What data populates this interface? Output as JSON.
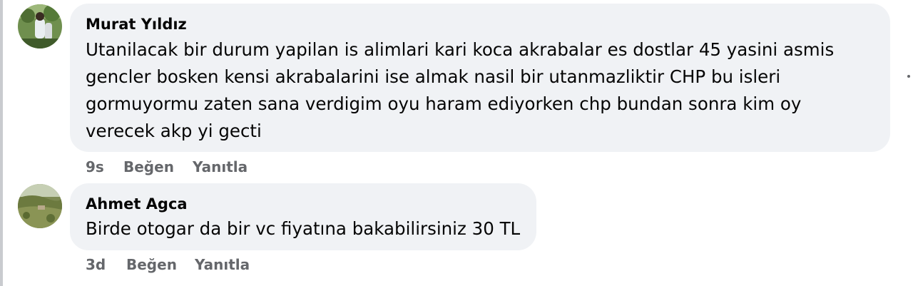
{
  "comments": [
    {
      "author": "Murat Yıldız",
      "lines": [
        "Utanilacak bir durum yapilan is alimlari kari koca akrabalar es dostlar 45 yasini asmis",
        "gencler bosken kensi akrabalarini ise almak nasil bir utanmazliktir CHP bu isleri",
        "gormuyormu zaten sana verdigim oyu haram ediyorken chp bundan sonra kim oy",
        "verecek akp yi gecti"
      ],
      "time": "9s",
      "like_label": "Beğen",
      "reply_label": "Yanıtla"
    },
    {
      "author": "Ahmet Agca",
      "lines": [
        "Birde otogar da bir vc fiyatına bakabilirsiniz 30 TL"
      ],
      "time": "3d",
      "like_label": "Beğen",
      "reply_label": "Yanıtla"
    }
  ],
  "icons": {
    "more_options": "more-options-icon"
  },
  "colors": {
    "bubble": "#f0f2f5",
    "text": "#050505",
    "meta": "#65676b"
  }
}
